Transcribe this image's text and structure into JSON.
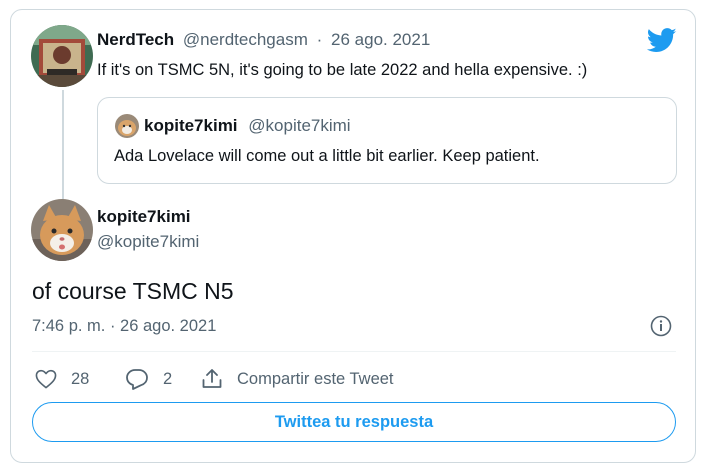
{
  "reply_tweet": {
    "display_name": "NerdTech",
    "handle": "@nerdtechgasm",
    "separator": "·",
    "date": "26 ago. 2021",
    "text": "If it's on TSMC 5N, it's going to be late 2022 and hella expensive. :)",
    "avatar_icon": "avatar-image"
  },
  "quoted_tweet": {
    "display_name": "kopite7kimi",
    "handle": "@kopite7kimi",
    "text": "Ada Lovelace will come out a little bit earlier. Keep patient."
  },
  "main_tweet": {
    "display_name": "kopite7kimi",
    "handle": "@kopite7kimi",
    "text": "of course TSMC N5",
    "timestamp": "7:46 p. m. · 26 ago. 2021"
  },
  "actions": {
    "likes": "28",
    "replies": "2",
    "share_label": "Compartir este Tweet"
  },
  "reply_button_label": "Twittea tu respuesta",
  "icons": {
    "brand": "twitter-bird-icon",
    "info": "info-icon",
    "like": "heart-icon",
    "reply": "reply-bubble-icon",
    "share": "share-icon"
  },
  "colors": {
    "accent": "#1d9bf0",
    "text": "#0f1419",
    "secondary": "#536471",
    "border": "#cfd9de"
  }
}
